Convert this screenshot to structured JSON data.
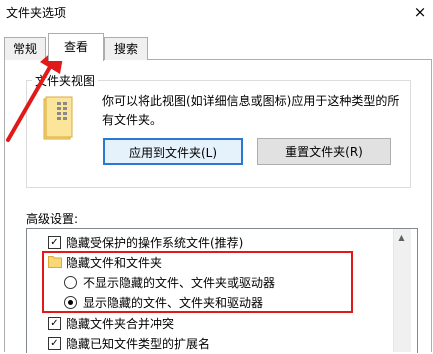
{
  "window": {
    "title": "文件夹选项",
    "close_glyph": "×"
  },
  "tabs": [
    {
      "label": "常规",
      "selected": false
    },
    {
      "label": "查看",
      "selected": true
    },
    {
      "label": "搜索",
      "selected": false
    }
  ],
  "folder_views": {
    "legend": "文件夹视图",
    "icon": "folder-grid-icon",
    "description": "你可以将此视图(如详细信息或图标)应用于这种类型的所有文件夹。",
    "apply_button": "应用到文件夹(L)",
    "reset_button": "重置文件夹(R)"
  },
  "advanced": {
    "label": "高级设置:",
    "items": [
      {
        "type": "checkbox",
        "label": "隐藏受保护的操作系统文件(推荐)",
        "checked": true
      },
      {
        "type": "folder",
        "label": "隐藏文件和文件夹"
      },
      {
        "type": "radio",
        "label": "不显示隐藏的文件、文件夹或驱动器",
        "checked": false
      },
      {
        "type": "radio",
        "label": "显示隐藏的文件、文件夹和驱动器",
        "checked": true
      },
      {
        "type": "checkbox",
        "label": "隐藏文件夹合并冲突",
        "checked": true
      },
      {
        "type": "checkbox",
        "label": "隐藏已知文件类型的扩展名",
        "checked": true
      }
    ]
  },
  "colors": {
    "accent": "#2b78d4",
    "annotation": "#e01a1a"
  }
}
